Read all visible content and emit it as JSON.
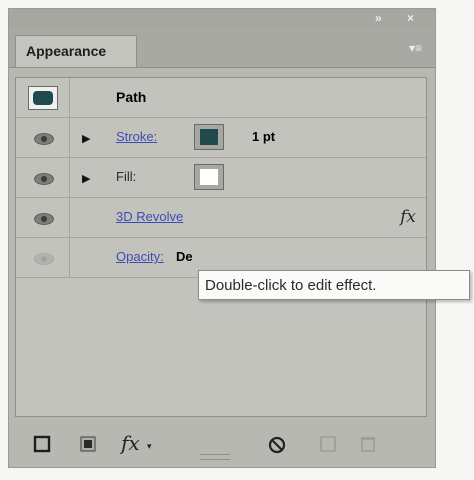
{
  "panel": {
    "tab_title": "Appearance",
    "collapse_glyph": "»",
    "close_glyph": "×",
    "menu_glyph": "▾≡"
  },
  "rows": {
    "path": {
      "label": "Path",
      "thumbnail_color": "#1f4b4f"
    },
    "stroke": {
      "label": "Stroke:",
      "swatch_color": "#1f4b4f",
      "weight": "1 pt"
    },
    "fill": {
      "label": "Fill:",
      "swatch_color": "#ffffff"
    },
    "effect": {
      "label": "3D Revolve",
      "fx": "fx"
    },
    "opacity": {
      "label": "Opacity:",
      "value": "De"
    }
  },
  "tooltip": {
    "text": "Double-click to edit effect."
  },
  "footer": {
    "fx_label": "fx"
  }
}
